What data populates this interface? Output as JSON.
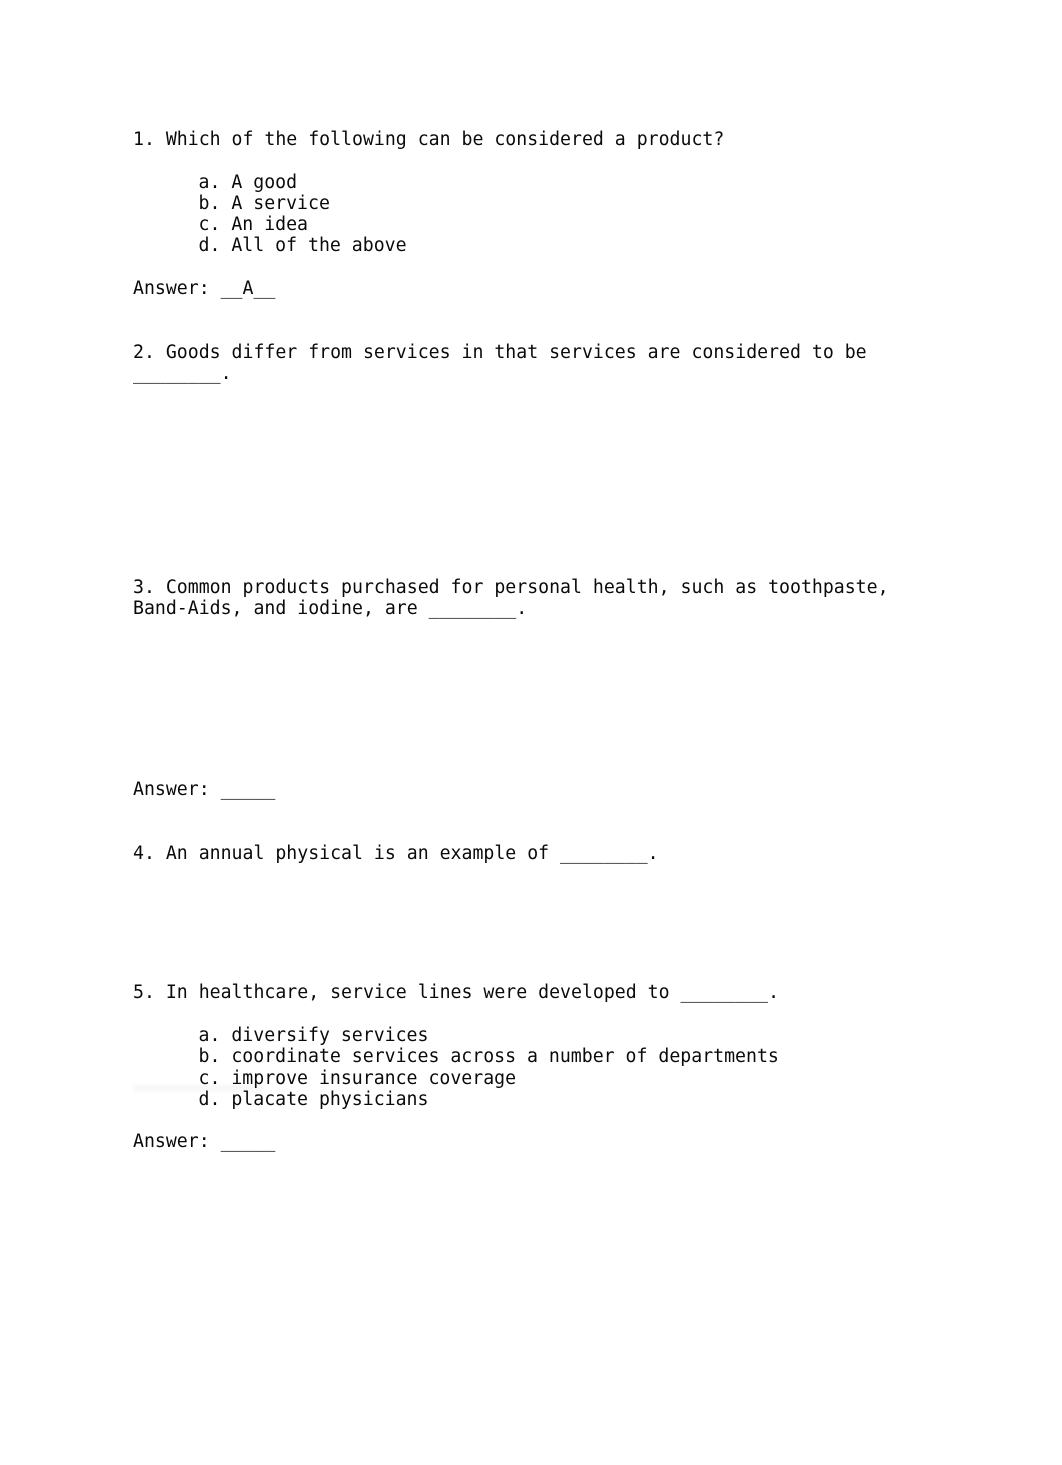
{
  "document": {
    "type": "quiz-worksheet",
    "background_color": "#ffffff",
    "text_color": "#0a0a0a"
  },
  "questions": [
    {
      "number": "1.",
      "text": "1. Which of the following can be considered a product?",
      "options": [
        "a. A good",
        "b. A service",
        "c. An idea",
        "d. All of the above"
      ],
      "answer_label": "Answer: __A__"
    },
    {
      "number": "2.",
      "text": "2. Goods differ from services in that services are considered to be\n________.",
      "options": [],
      "answer_label": ""
    },
    {
      "number": "3.",
      "text": "3. Common products purchased for personal health, such as toothpaste,\nBand-Aids, and iodine, are ________.",
      "options": [],
      "answer_label": "Answer: _____"
    },
    {
      "number": "4.",
      "text": "4. An annual physical is an example of ________.",
      "options": [],
      "answer_label": ""
    },
    {
      "number": "5.",
      "text": "5. In healthcare, service lines were developed to ________.",
      "options": [
        "a. diversify services",
        "b. coordinate services across a number of departments",
        "c. improve insurance coverage",
        "d. placate physicians"
      ],
      "answer_label": "Answer: _____"
    }
  ]
}
